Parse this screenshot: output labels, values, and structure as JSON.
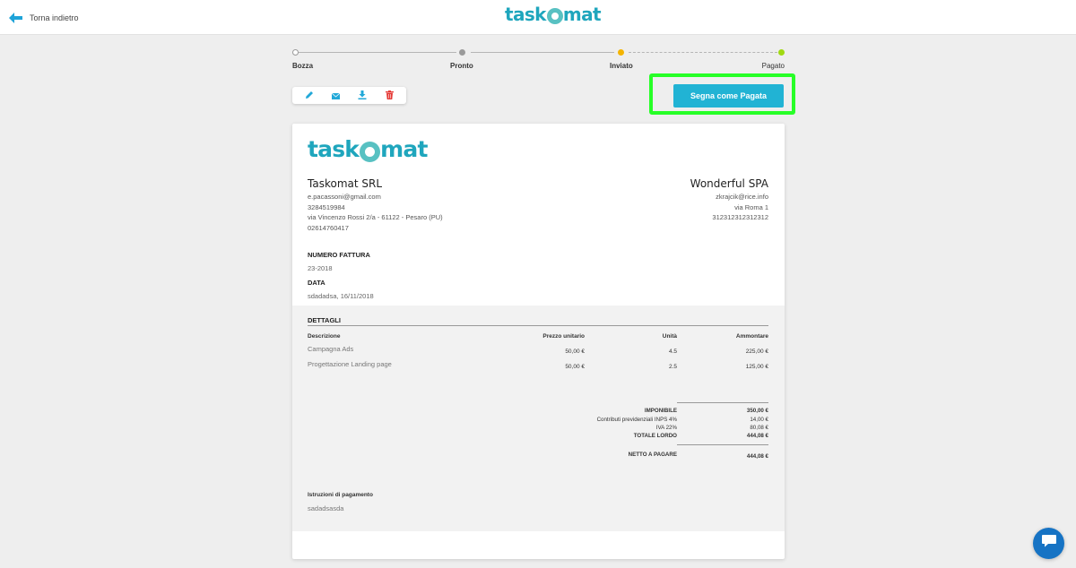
{
  "topbar": {
    "back_label": "Torna indietro",
    "brand": {
      "before": "task",
      "after": "mat"
    }
  },
  "steps": [
    {
      "label": "Bozza",
      "color": "#ffffff"
    },
    {
      "label": "Pronto",
      "color": "#9a9a9a"
    },
    {
      "label": "Inviato",
      "color": "#f4b400"
    },
    {
      "label": "Pagato",
      "color": "#a0d911"
    }
  ],
  "toolbar": {
    "icons": [
      "pencil-icon",
      "envelope-icon",
      "download-icon",
      "trash-icon"
    ],
    "accent": "#21a8d8",
    "danger": "#e53935"
  },
  "actions": {
    "mark_paid_label": "Segna come Pagata",
    "highlight_color": "#27ff27"
  },
  "invoice": {
    "brand": {
      "before": "task",
      "after": "mat"
    },
    "sender": {
      "name": "Taskomat SRL",
      "email": "e.pacassoni@gmail.com",
      "phone": "3284519984",
      "address": "via Vincenzo Rossi 2/a - 61122 - Pesaro (PU)",
      "vat": "02614760417"
    },
    "recipient": {
      "name": "Wonderful SPA",
      "email": "zkrajcik@rice.info",
      "address": "via Roma 1",
      "vat": "312312312312312"
    },
    "number_label": "NUMERO FATTURA",
    "number": "23-2018",
    "date_label": "DATA",
    "date": "sdadadsa, 16/11/2018",
    "details": {
      "title": "DETTAGLI",
      "columns": [
        "Descrizione",
        "Prezzo unitario",
        "Unità",
        "Ammontare"
      ],
      "rows": [
        {
          "description": "Campagna Ads",
          "unit_price": "50,00 €",
          "units": "4.5",
          "amount": "225,00 €"
        },
        {
          "description": "Progettazione Landing page",
          "unit_price": "50,00 €",
          "units": "2.5",
          "amount": "125,00 €"
        }
      ]
    },
    "summary": {
      "taxable_label": "IMPONIBILE",
      "taxable": "350,00 €",
      "inps_label": "Contributi previdenziali INPS 4%",
      "inps": "14,00 €",
      "iva_label": "IVA 22%",
      "iva": "80,08 €",
      "gross_label": "TOTALE LORDO",
      "gross": "444,08 €",
      "net_label": "NETTO A PAGARE",
      "net": "444,08 €"
    },
    "payment": {
      "title": "Istruzioni di pagamento",
      "text": "sadadsasda"
    }
  },
  "chat": {
    "icon": "chat-icon",
    "color": "#1673c4"
  }
}
